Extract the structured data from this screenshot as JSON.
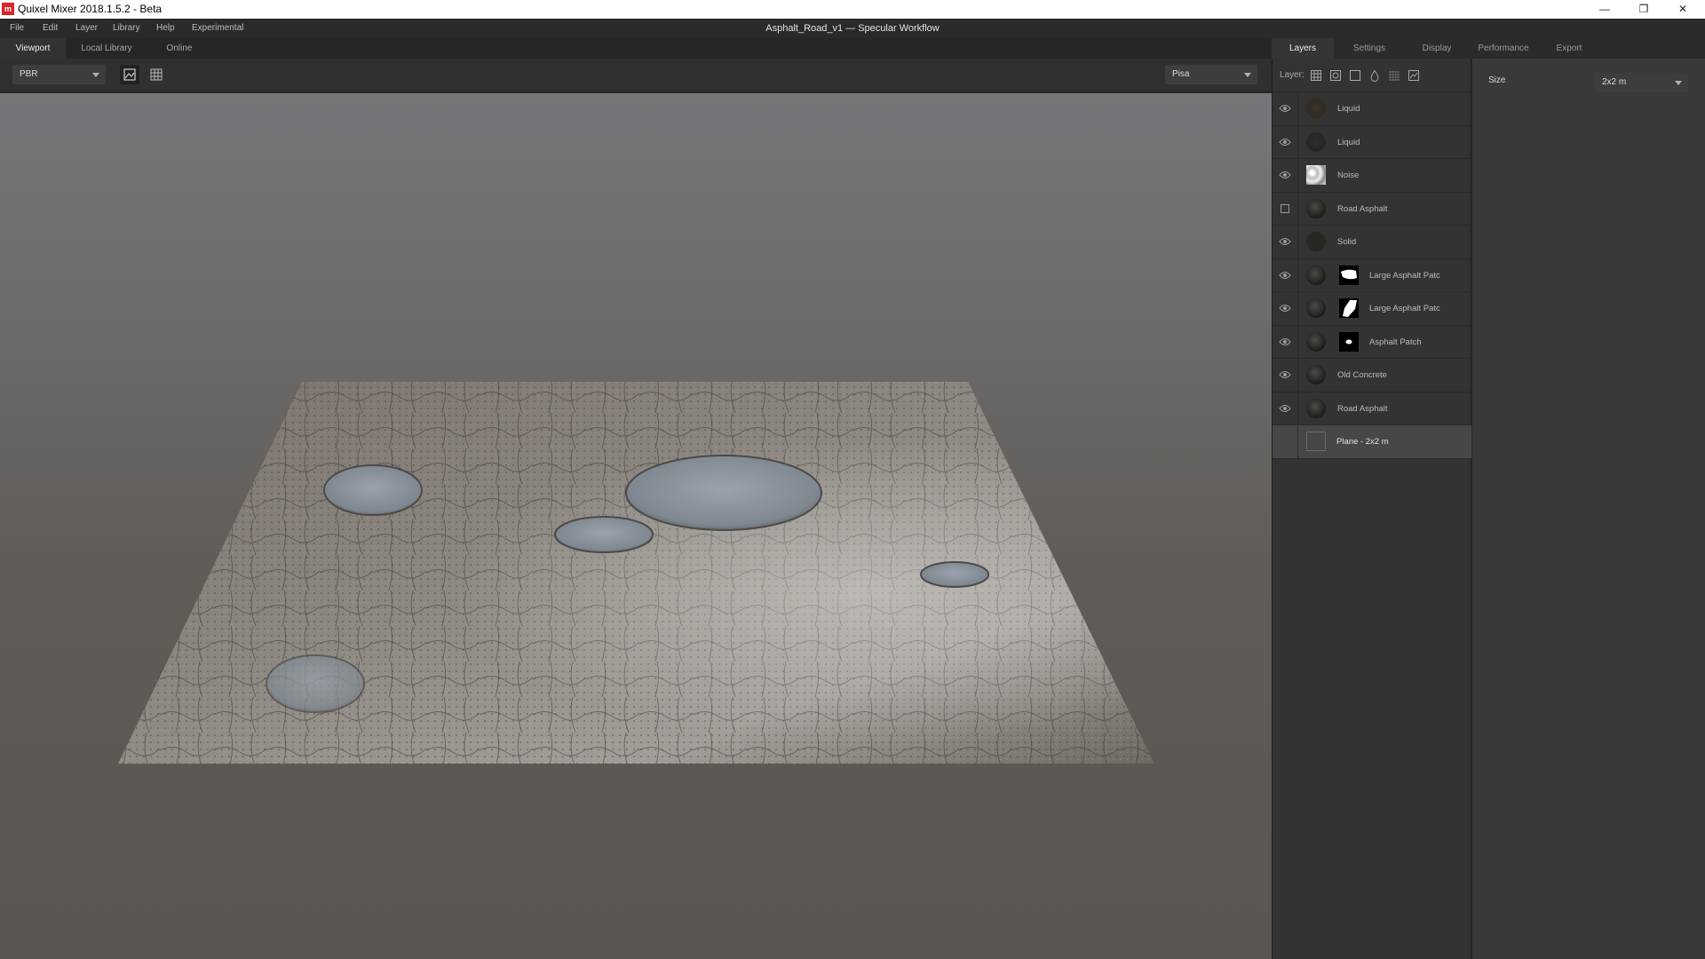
{
  "window": {
    "title": "Quixel Mixer 2018.1.5.2 - Beta",
    "logo_text": "m",
    "minimize": "—",
    "restore": "❐",
    "close": "✕"
  },
  "menu": {
    "items": [
      "File",
      "Edit",
      "Layer",
      "Library",
      "Help",
      "Experimental"
    ]
  },
  "document_title": "Asphalt_Road_v1 — Specular Workflow",
  "left_tabs": [
    {
      "label": "Viewport"
    },
    {
      "label": "Local Library"
    },
    {
      "label": "Online"
    }
  ],
  "viewport_toolbar": {
    "render_mode": "PBR",
    "environment": "Pisa"
  },
  "right_tabs": [
    {
      "label": "Layers"
    },
    {
      "label": "Settings"
    },
    {
      "label": "Display"
    },
    {
      "label": "Performance"
    },
    {
      "label": "Export"
    }
  ],
  "layer_toolbar": {
    "label": "Layer:"
  },
  "layers": [
    {
      "name": "Liquid",
      "visibility": "visible"
    },
    {
      "name": "Liquid",
      "visibility": "visible"
    },
    {
      "name": "Noise",
      "visibility": "visible"
    },
    {
      "name": "Road Asphalt",
      "visibility": "hidden"
    },
    {
      "name": "Solid",
      "visibility": "visible"
    },
    {
      "name": "Large Asphalt Patc",
      "visibility": "visible",
      "has_mask": true
    },
    {
      "name": "Large Asphalt Patc",
      "visibility": "visible",
      "has_mask": true
    },
    {
      "name": "Asphalt Patch",
      "visibility": "visible",
      "has_mask": true
    },
    {
      "name": "Old Concrete",
      "visibility": "visible"
    },
    {
      "name": "Road Asphalt",
      "visibility": "visible"
    },
    {
      "name": "Plane - 2x2 m",
      "selected": true
    }
  ],
  "properties": {
    "size_label": "Size",
    "size_value": "2x2 m"
  },
  "colors": {
    "accent": "#d8242b",
    "panel": "#333333",
    "selected_row": "#474747"
  }
}
